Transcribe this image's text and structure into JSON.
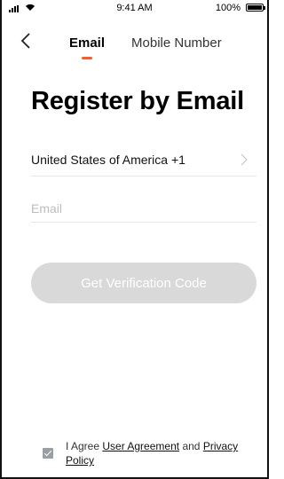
{
  "status_bar": {
    "time": "9:41 AM",
    "battery": "100%"
  },
  "tabs": [
    {
      "label": "Email",
      "active": true
    },
    {
      "label": "Mobile Number",
      "active": false
    }
  ],
  "accent_color": "#ff5a28",
  "title": "Register by Email",
  "country": {
    "label": "United States of America +1"
  },
  "email": {
    "placeholder": "Email",
    "value": ""
  },
  "verify_button": {
    "label": "Get Verification Code",
    "enabled": false
  },
  "agreement": {
    "prefix": "I Agree",
    "user_agreement": "User Agreement",
    "and": "and",
    "privacy_policy": "Privacy Policy",
    "checked": true
  }
}
